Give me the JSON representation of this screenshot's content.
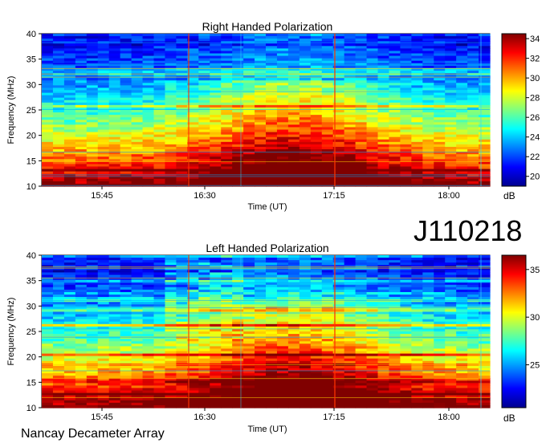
{
  "dataset_id": "J110218",
  "footer": "Nancay Decameter Array",
  "chart_data": [
    {
      "type": "heatmap",
      "title": "Right Handed Polarization",
      "xlabel": "Time (UT)",
      "ylabel": "Frequency (MHz)",
      "x_ticks": [
        "15:45",
        "16:30",
        "17:15",
        "18:00"
      ],
      "y_ticks": [
        10,
        15,
        20,
        25,
        30,
        35,
        40
      ],
      "ylim": [
        10,
        40
      ],
      "colorbar": {
        "label": "dB",
        "ticks": [
          20,
          22,
          24,
          26,
          28,
          30,
          32,
          34
        ],
        "range": [
          19,
          34.5
        ]
      },
      "colormap": "jet"
    },
    {
      "type": "heatmap",
      "title": "Left Handed Polarization",
      "xlabel": "Time (UT)",
      "ylabel": "Frequency (MHz)",
      "x_ticks": [
        "15:45",
        "16:30",
        "17:15",
        "18:00"
      ],
      "y_ticks": [
        10,
        15,
        20,
        25,
        30,
        35,
        40
      ],
      "ylim": [
        10,
        40
      ],
      "colorbar": {
        "label": "dB",
        "ticks": [
          25,
          30,
          35
        ],
        "range": [
          20.5,
          36.5
        ]
      },
      "colormap": "jet"
    }
  ]
}
